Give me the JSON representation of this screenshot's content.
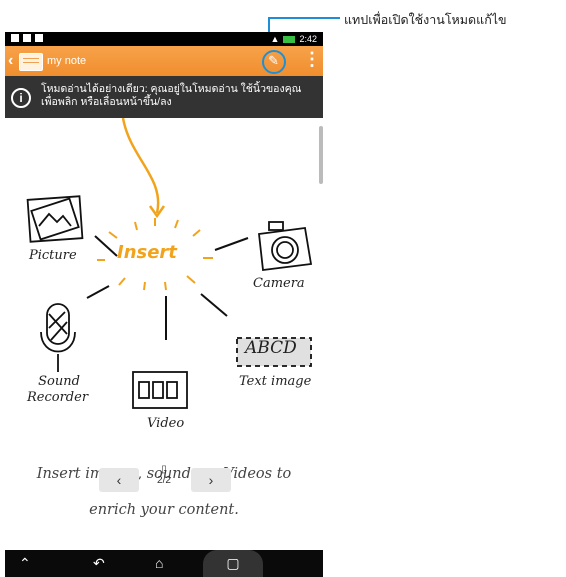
{
  "statusbar": {
    "time": "2:42"
  },
  "titlebar": {
    "title": "my note"
  },
  "infobar": {
    "text": "โหมดอ่านได้อย่างเดียว: คุณอยู่ในโหมดอ่าน ใช้นิ้วของคุณเพื่อพลิก หรือเลื่อนหน้าขึ้น/ลง"
  },
  "illustration": {
    "center": "Insert",
    "picture": "Picture",
    "camera": "Camera",
    "sound": "Sound",
    "recorder": "Recorder",
    "video": "Video",
    "text_image": "Text image",
    "abcd": "ABCD"
  },
  "caption": {
    "line1": "Insert images, sounds or Videos to",
    "line2": "enrich your content."
  },
  "pager": {
    "prev": "‹",
    "next": "›",
    "page": "2/2"
  },
  "callout": {
    "text": "แทปเพื่อเปิดใช้งานโหมดแก้ไข"
  },
  "colors": {
    "accent": "#ef8e2e",
    "callout": "#1e8fd6",
    "insert": "#f2a31c"
  }
}
